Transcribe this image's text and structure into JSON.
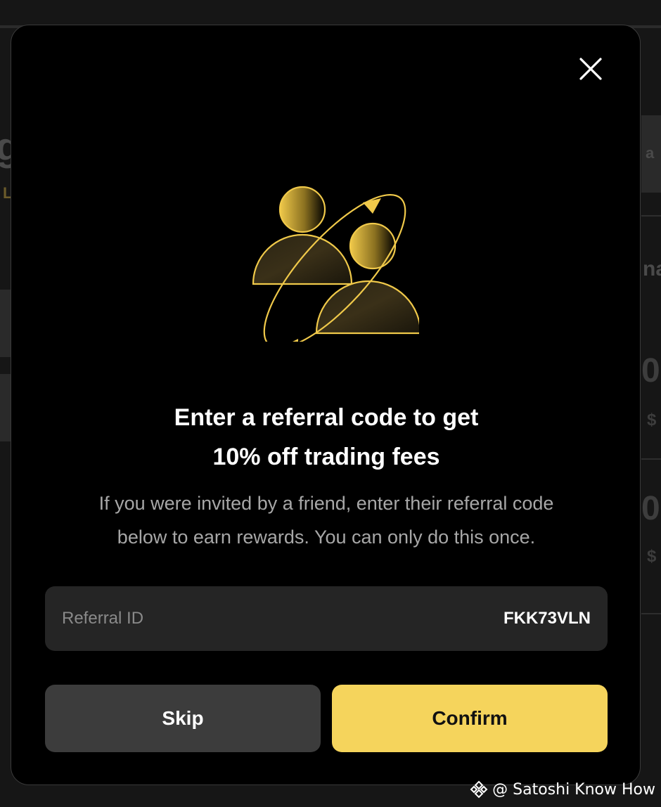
{
  "background": {
    "fragments": [
      "g",
      "L",
      "a",
      "na",
      "0",
      "$",
      "0",
      "$"
    ]
  },
  "modal": {
    "close_icon": "close-icon",
    "illustration_icon": "referral-friends-icon",
    "title_line1": "Enter a referral code to get",
    "title_line2": "10% off trading fees",
    "description_line1": "If you were invited by a friend, enter their referral code",
    "description_line2": "below to earn rewards. You can only do this once.",
    "referral_field": {
      "label": "Referral ID",
      "value": "FKK73VLN"
    },
    "skip_label": "Skip",
    "confirm_label": "Confirm"
  },
  "watermark": {
    "text": "@ Satoshi Know How",
    "icon": "binance-logo-icon"
  },
  "colors": {
    "accent": "#F5D45C",
    "modal_bg": "#000000",
    "field_bg": "#252525",
    "skip_bg": "#3C3C3C"
  }
}
